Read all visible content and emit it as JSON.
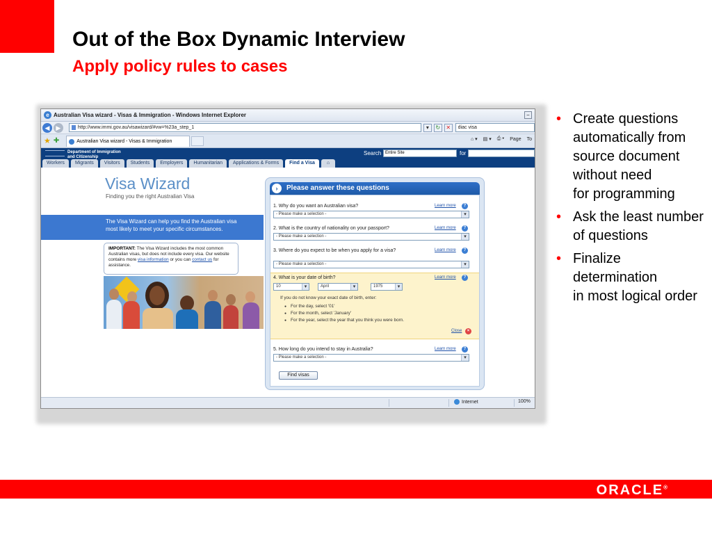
{
  "slide": {
    "title": "Out of the Box Dynamic Interview",
    "subtitle": "Apply policy rules to cases",
    "bullets": [
      "Create questions automatically from source document without need\nfor programming",
      "Ask the least number of questions",
      "Finalize determination\nin most logical order"
    ],
    "logo": "ORACLE",
    "colors": {
      "brand_red": "#ff0000"
    }
  },
  "browser": {
    "window_title": "Australian Visa wizard - Visas & Immigration - Windows Internet Explorer",
    "address_url": "http://www.immi.gov.au/visawizard/#vw=%23a_step_1",
    "search_value": "diac visa",
    "tab_label": "Australian Visa wizard - Visas & Immigration",
    "tools": {
      "page": "Page",
      "tools": "To"
    },
    "status": {
      "zone": "Internet",
      "zoom": "100%"
    }
  },
  "site": {
    "department": "Department of Immigration\nand Citizenship",
    "search_label": "Search",
    "search_scope": "Entire Site",
    "search_for": "for",
    "nav": [
      "Workers",
      "Migrants",
      "Visitors",
      "Students",
      "Employers",
      "Humanitarian",
      "Applications & Forms",
      "Find a Visa"
    ]
  },
  "wizard": {
    "title": "Visa Wizard",
    "tagline": "Finding you the right Australian Visa",
    "intro": "The Visa Wizard can help you find the Australian visa most likely to meet your specific circumstances.",
    "important_label": "IMPORTANT:",
    "important_text_1": "The Visa Wizard includes the most common Australian visas, but does not include every visa. Our website contains more",
    "important_link_1": "visa information",
    "important_text_2": "or you can",
    "important_link_2": "contact us",
    "important_text_3": "for assistance.",
    "panel_heading": "Please answer these questions",
    "learn_more": "Learn more",
    "help_glyph": "?",
    "questions": [
      {
        "text": "1. Why do you want an Australian visa?",
        "select": "- Please make a selection -"
      },
      {
        "text": "2. What is the country of nationality on your passport?",
        "select": "- Please make a selection -"
      },
      {
        "text": "3. Where do you expect to be when you apply for a visa?",
        "select": "- Please make a selection -"
      },
      {
        "text": "4. What is your date of birth?"
      },
      {
        "text": "5. How long do you intend to stay in Australia?",
        "select": "- Please make a selection -"
      }
    ],
    "dob": {
      "day": "10",
      "month": "April",
      "year": "1975",
      "hint": "If you do not know your exact date of birth, enter:",
      "tips": [
        "For the day, select '01'",
        "For the month, select 'January'",
        "For the year, select the year that you think you were born."
      ],
      "close": "Close"
    },
    "submit": "Find visas"
  }
}
